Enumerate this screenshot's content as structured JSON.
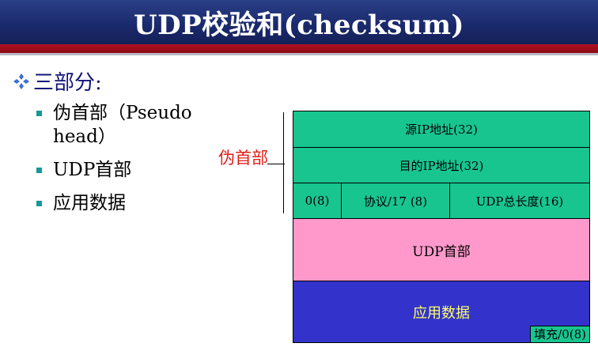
{
  "title": "UDP校验和(checksum)",
  "heading": "三部分:",
  "bullets": [
    {
      "line1": "伪首部（Pseudo",
      "line2": "head）"
    },
    {
      "line1": "UDP首部"
    },
    {
      "line1": "应用数据"
    }
  ],
  "pseudo_label": "伪首部",
  "diagram": {
    "source_ip": "源IP地址(32)",
    "dest_ip": "目的IP地址(32)",
    "zero": "0(8)",
    "protocol": "协议/17 (8)",
    "udp_length": "UDP总长度(16)",
    "udp_header": "UDP首部",
    "app_data": "应用数据",
    "padding": "填充/0(8)"
  },
  "colors": {
    "title_bg": "#1b2a6e",
    "green": "#18c58f",
    "pink": "#ff99cc",
    "blue": "#3333cc",
    "label_red": "#e0201a",
    "bullet_teal": "#149999"
  }
}
